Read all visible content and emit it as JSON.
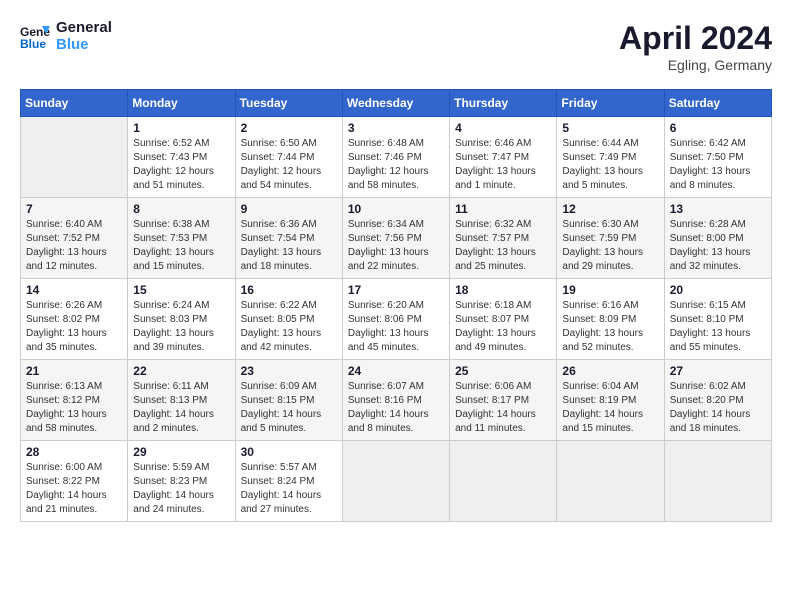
{
  "header": {
    "logo_line1": "General",
    "logo_line2": "Blue",
    "month_year": "April 2024",
    "location": "Egling, Germany"
  },
  "weekdays": [
    "Sunday",
    "Monday",
    "Tuesday",
    "Wednesday",
    "Thursday",
    "Friday",
    "Saturday"
  ],
  "weeks": [
    [
      {
        "num": "",
        "sunrise": "",
        "sunset": "",
        "daylight": "",
        "empty": true
      },
      {
        "num": "1",
        "sunrise": "Sunrise: 6:52 AM",
        "sunset": "Sunset: 7:43 PM",
        "daylight": "Daylight: 12 hours and 51 minutes."
      },
      {
        "num": "2",
        "sunrise": "Sunrise: 6:50 AM",
        "sunset": "Sunset: 7:44 PM",
        "daylight": "Daylight: 12 hours and 54 minutes."
      },
      {
        "num": "3",
        "sunrise": "Sunrise: 6:48 AM",
        "sunset": "Sunset: 7:46 PM",
        "daylight": "Daylight: 12 hours and 58 minutes."
      },
      {
        "num": "4",
        "sunrise": "Sunrise: 6:46 AM",
        "sunset": "Sunset: 7:47 PM",
        "daylight": "Daylight: 13 hours and 1 minute."
      },
      {
        "num": "5",
        "sunrise": "Sunrise: 6:44 AM",
        "sunset": "Sunset: 7:49 PM",
        "daylight": "Daylight: 13 hours and 5 minutes."
      },
      {
        "num": "6",
        "sunrise": "Sunrise: 6:42 AM",
        "sunset": "Sunset: 7:50 PM",
        "daylight": "Daylight: 13 hours and 8 minutes."
      }
    ],
    [
      {
        "num": "7",
        "sunrise": "Sunrise: 6:40 AM",
        "sunset": "Sunset: 7:52 PM",
        "daylight": "Daylight: 13 hours and 12 minutes."
      },
      {
        "num": "8",
        "sunrise": "Sunrise: 6:38 AM",
        "sunset": "Sunset: 7:53 PM",
        "daylight": "Daylight: 13 hours and 15 minutes."
      },
      {
        "num": "9",
        "sunrise": "Sunrise: 6:36 AM",
        "sunset": "Sunset: 7:54 PM",
        "daylight": "Daylight: 13 hours and 18 minutes."
      },
      {
        "num": "10",
        "sunrise": "Sunrise: 6:34 AM",
        "sunset": "Sunset: 7:56 PM",
        "daylight": "Daylight: 13 hours and 22 minutes."
      },
      {
        "num": "11",
        "sunrise": "Sunrise: 6:32 AM",
        "sunset": "Sunset: 7:57 PM",
        "daylight": "Daylight: 13 hours and 25 minutes."
      },
      {
        "num": "12",
        "sunrise": "Sunrise: 6:30 AM",
        "sunset": "Sunset: 7:59 PM",
        "daylight": "Daylight: 13 hours and 29 minutes."
      },
      {
        "num": "13",
        "sunrise": "Sunrise: 6:28 AM",
        "sunset": "Sunset: 8:00 PM",
        "daylight": "Daylight: 13 hours and 32 minutes."
      }
    ],
    [
      {
        "num": "14",
        "sunrise": "Sunrise: 6:26 AM",
        "sunset": "Sunset: 8:02 PM",
        "daylight": "Daylight: 13 hours and 35 minutes."
      },
      {
        "num": "15",
        "sunrise": "Sunrise: 6:24 AM",
        "sunset": "Sunset: 8:03 PM",
        "daylight": "Daylight: 13 hours and 39 minutes."
      },
      {
        "num": "16",
        "sunrise": "Sunrise: 6:22 AM",
        "sunset": "Sunset: 8:05 PM",
        "daylight": "Daylight: 13 hours and 42 minutes."
      },
      {
        "num": "17",
        "sunrise": "Sunrise: 6:20 AM",
        "sunset": "Sunset: 8:06 PM",
        "daylight": "Daylight: 13 hours and 45 minutes."
      },
      {
        "num": "18",
        "sunrise": "Sunrise: 6:18 AM",
        "sunset": "Sunset: 8:07 PM",
        "daylight": "Daylight: 13 hours and 49 minutes."
      },
      {
        "num": "19",
        "sunrise": "Sunrise: 6:16 AM",
        "sunset": "Sunset: 8:09 PM",
        "daylight": "Daylight: 13 hours and 52 minutes."
      },
      {
        "num": "20",
        "sunrise": "Sunrise: 6:15 AM",
        "sunset": "Sunset: 8:10 PM",
        "daylight": "Daylight: 13 hours and 55 minutes."
      }
    ],
    [
      {
        "num": "21",
        "sunrise": "Sunrise: 6:13 AM",
        "sunset": "Sunset: 8:12 PM",
        "daylight": "Daylight: 13 hours and 58 minutes."
      },
      {
        "num": "22",
        "sunrise": "Sunrise: 6:11 AM",
        "sunset": "Sunset: 8:13 PM",
        "daylight": "Daylight: 14 hours and 2 minutes."
      },
      {
        "num": "23",
        "sunrise": "Sunrise: 6:09 AM",
        "sunset": "Sunset: 8:15 PM",
        "daylight": "Daylight: 14 hours and 5 minutes."
      },
      {
        "num": "24",
        "sunrise": "Sunrise: 6:07 AM",
        "sunset": "Sunset: 8:16 PM",
        "daylight": "Daylight: 14 hours and 8 minutes."
      },
      {
        "num": "25",
        "sunrise": "Sunrise: 6:06 AM",
        "sunset": "Sunset: 8:17 PM",
        "daylight": "Daylight: 14 hours and 11 minutes."
      },
      {
        "num": "26",
        "sunrise": "Sunrise: 6:04 AM",
        "sunset": "Sunset: 8:19 PM",
        "daylight": "Daylight: 14 hours and 15 minutes."
      },
      {
        "num": "27",
        "sunrise": "Sunrise: 6:02 AM",
        "sunset": "Sunset: 8:20 PM",
        "daylight": "Daylight: 14 hours and 18 minutes."
      }
    ],
    [
      {
        "num": "28",
        "sunrise": "Sunrise: 6:00 AM",
        "sunset": "Sunset: 8:22 PM",
        "daylight": "Daylight: 14 hours and 21 minutes."
      },
      {
        "num": "29",
        "sunrise": "Sunrise: 5:59 AM",
        "sunset": "Sunset: 8:23 PM",
        "daylight": "Daylight: 14 hours and 24 minutes."
      },
      {
        "num": "30",
        "sunrise": "Sunrise: 5:57 AM",
        "sunset": "Sunset: 8:24 PM",
        "daylight": "Daylight: 14 hours and 27 minutes."
      },
      {
        "num": "",
        "sunrise": "",
        "sunset": "",
        "daylight": "",
        "empty": true
      },
      {
        "num": "",
        "sunrise": "",
        "sunset": "",
        "daylight": "",
        "empty": true
      },
      {
        "num": "",
        "sunrise": "",
        "sunset": "",
        "daylight": "",
        "empty": true
      },
      {
        "num": "",
        "sunrise": "",
        "sunset": "",
        "daylight": "",
        "empty": true
      }
    ]
  ]
}
